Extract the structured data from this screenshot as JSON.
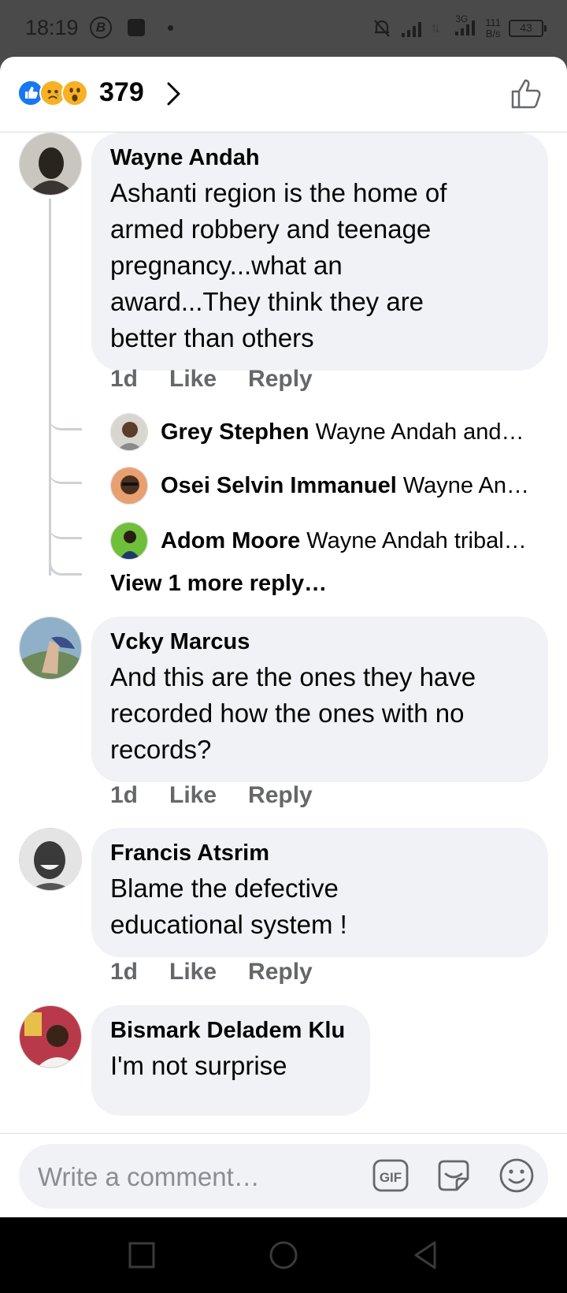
{
  "status_bar": {
    "time": "18:19",
    "b_icon_label": "B",
    "net_top": "3G",
    "speed_value": "111",
    "speed_unit": "B/s",
    "battery": "43"
  },
  "header": {
    "reaction_count": "379",
    "reactions": [
      "like-icon",
      "sad-icon",
      "wow-icon"
    ]
  },
  "comments": [
    {
      "name": "Wayne Andah",
      "lines": [
        "Ashanti region is the home of",
        "armed robbery and teenage",
        "pregnancy...what an",
        "award...They think they are",
        "better than others"
      ],
      "time": "1d",
      "like": "Like",
      "reply": "Reply",
      "replies": [
        {
          "name": "Grey Stephen",
          "text": "Wayne Andah and…"
        },
        {
          "name": "Osei Selvin Immanuel",
          "text": "Wayne An…"
        },
        {
          "name": "Adom Moore",
          "text": "Wayne Andah tribal…"
        }
      ],
      "view_more": "View 1 more reply…"
    },
    {
      "name": "Vcky Marcus",
      "lines": [
        "And this are the ones they have",
        "recorded how the ones with no",
        "records?"
      ],
      "time": "1d",
      "like": "Like",
      "reply": "Reply"
    },
    {
      "name": "Francis Atsrim",
      "lines": [
        "Blame the defective",
        "educational system !"
      ],
      "time": "1d",
      "like": "Like",
      "reply": "Reply"
    },
    {
      "name": "Bismark Deladem Klu",
      "lines": [
        "I'm not surprise"
      ]
    }
  ],
  "composer": {
    "placeholder": "Write a comment…",
    "gif_label": "GIF"
  },
  "colors": {
    "like_blue": "#1877f2",
    "bubble_gray": "#f0f2f5",
    "action_gray": "#65676b"
  }
}
